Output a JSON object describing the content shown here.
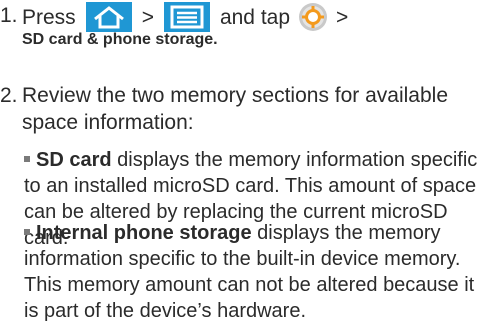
{
  "step1": {
    "number": "1.",
    "press": "Press",
    "sep1": ">",
    "and_tap": "and tap",
    "sep2": ">",
    "destination": "SD card & phone storage.",
    "icons": [
      "home-icon",
      "menu-icon",
      "settings-icon"
    ],
    "icon_color": "#1f97d4"
  },
  "step2": {
    "number": "2.",
    "text": "Review the two memory sections for available space information:"
  },
  "bullets": [
    {
      "term": "SD card",
      "text": " displays the memory information specific to an installed microSD card. This amount of space can be altered by replacing the current microSD card."
    },
    {
      "term": "Internal phone storage",
      "text": " displays the memory information specific to the built-in device memory. This memory amount can not be altered because it is part of the device’s hardware."
    }
  ]
}
